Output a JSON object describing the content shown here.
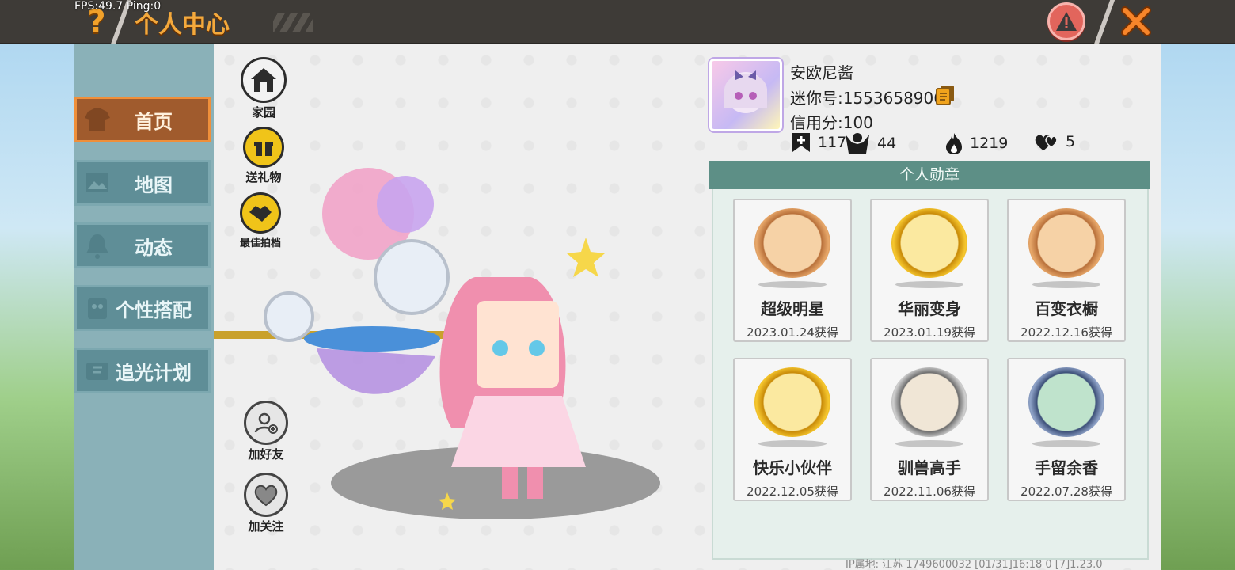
{
  "hud": {
    "fps_label": "FPS:49.7  Ping:0"
  },
  "header": {
    "title": "个人中心",
    "help_glyph": "?"
  },
  "nav": {
    "items": [
      {
        "label": "首页",
        "active": true
      },
      {
        "label": "地图",
        "active": false
      },
      {
        "label": "动态",
        "active": false
      },
      {
        "label": "个性搭配",
        "active": false
      },
      {
        "label": "追光计划",
        "active": false
      }
    ]
  },
  "actions": {
    "home": "家园",
    "gift": "送礼物",
    "partner": "最佳拍档",
    "add_friend": "加好友",
    "follow": "加关注"
  },
  "profile": {
    "name": "安欧尼酱",
    "mini_id": "迷你号:1553658906",
    "credit": "信用分:100",
    "stats": {
      "flag": "117",
      "fans": "44",
      "fire": "1219",
      "likes": "5"
    }
  },
  "medals": {
    "header": "个人勋章",
    "items": [
      {
        "name": "超级明星",
        "date": "2023.01.24获得",
        "tier": "bronze"
      },
      {
        "name": "华丽变身",
        "date": "2023.01.19获得",
        "tier": "gold"
      },
      {
        "name": "百变衣橱",
        "date": "2022.12.16获得",
        "tier": "bronze"
      },
      {
        "name": "快乐小伙伴",
        "date": "2022.12.05获得",
        "tier": "gold"
      },
      {
        "name": "驯兽高手",
        "date": "2022.11.06获得",
        "tier": "silver"
      },
      {
        "name": "手留余香",
        "date": "2022.07.28获得",
        "tier": "platinum"
      }
    ]
  },
  "footer": {
    "info": "IP属地: 江苏      1749600032    [01/31]16:18 0  [7]1.23.0"
  },
  "colors": {
    "accent_orange": "#f4a93c",
    "nav_active": "#a05b2d",
    "nav_idle": "#5f8e97",
    "medal_header": "#5d8f86"
  }
}
